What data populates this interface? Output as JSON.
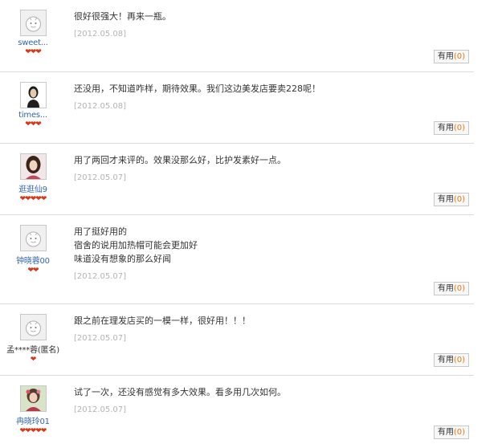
{
  "reviews": [
    {
      "username": "sweet...",
      "avatar_icon": "default-avatar-icon",
      "rank": "❤❤❤",
      "lines": [
        "很好很强大！再来一瓶。"
      ],
      "date": "[2012.05.08]",
      "useful_label": "有用",
      "useful_count": "(0)"
    },
    {
      "username": "times...",
      "avatar_icon": "user-photo-avatar",
      "rank": "❤❤❤",
      "lines": [
        "还没用，不知道咋样，期待效果。我们这边美发店要卖228呢！"
      ],
      "date": "[2012.05.08]",
      "useful_label": "有用",
      "useful_count": "(0)"
    },
    {
      "username": "逛逛仙9",
      "avatar_icon": "user-photo-avatar",
      "rank": "❤❤❤❤❤",
      "lines": [
        "用了两回才来评的。效果没那么好，比护发素好一点。"
      ],
      "date": "[2012.05.07]",
      "useful_label": "有用",
      "useful_count": "(0)"
    },
    {
      "username": "钟晓蓉00",
      "avatar_icon": "default-avatar-icon",
      "rank": "❤❤",
      "lines": [
        "用了挺好用的",
        "宿舍的说用加热帽可能会更加好",
        "味道没有想象的那么好闻"
      ],
      "date": "[2012.05.07]",
      "useful_label": "有用",
      "useful_count": "(0)"
    },
    {
      "username": "孟****蓉(匿名)",
      "avatar_icon": "default-avatar-icon",
      "rank": "❤",
      "lines": [
        "跟之前在理发店买的一模一样，很好用！！！"
      ],
      "date": "[2012.05.07]",
      "useful_label": "有用",
      "useful_count": "(0)"
    },
    {
      "username": "冉晓玲01",
      "avatar_icon": "user-photo-avatar",
      "rank": "❤❤❤❤❤",
      "lines": [
        "试了一次，还没有感觉有多大效果。看多用几次如何。"
      ],
      "date": "[2012.05.07]",
      "useful_label": "有用",
      "useful_count": "(0)"
    }
  ]
}
